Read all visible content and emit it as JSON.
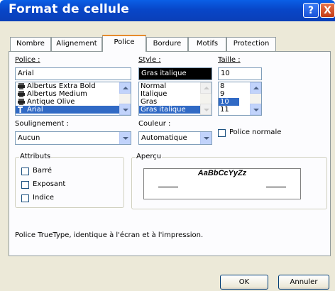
{
  "window": {
    "title": "Format de cellule",
    "help_glyph": "?",
    "close_glyph": "X"
  },
  "tabs": [
    {
      "label": "Nombre",
      "active": false
    },
    {
      "label": "Alignement",
      "active": false
    },
    {
      "label": "Police",
      "active": true
    },
    {
      "label": "Bordure",
      "active": false
    },
    {
      "label": "Motifs",
      "active": false
    },
    {
      "label": "Protection",
      "active": false
    }
  ],
  "police": {
    "label": "Police :",
    "value": "Arial",
    "items": [
      {
        "label": "Albertus Extra Bold",
        "icon": "printer-font-icon"
      },
      {
        "label": "Albertus Medium",
        "icon": "printer-font-icon"
      },
      {
        "label": "Antique Olive",
        "icon": "printer-font-icon"
      },
      {
        "label": "Arial",
        "icon": "truetype-icon",
        "selected": true
      }
    ]
  },
  "style": {
    "label": "Style :",
    "value": "Gras italique",
    "items": [
      {
        "label": "Normal"
      },
      {
        "label": "Italique"
      },
      {
        "label": "Gras"
      },
      {
        "label": "Gras italique",
        "selected": true
      }
    ]
  },
  "taille": {
    "label": "Taille :",
    "value": "10",
    "items": [
      {
        "label": "8"
      },
      {
        "label": "9"
      },
      {
        "label": "10",
        "selected": true
      },
      {
        "label": "11"
      }
    ]
  },
  "soulignement": {
    "label": "Soulignement :",
    "value": "Aucun"
  },
  "couleur": {
    "label": "Couleur :",
    "value": "Automatique"
  },
  "police_normale": {
    "label": "Police normale",
    "checked": false
  },
  "attributs": {
    "title": "Attributs",
    "items": [
      {
        "label": "Barré",
        "checked": false
      },
      {
        "label": "Exposant",
        "checked": false
      },
      {
        "label": "Indice",
        "checked": false
      }
    ]
  },
  "apercu": {
    "title": "Aperçu",
    "sample": "AaBbCcYyZz"
  },
  "info": "Police TrueType, identique à l'écran et à l'impression.",
  "buttons": {
    "ok": "OK",
    "cancel": "Annuler"
  },
  "colors": {
    "title_bar": "#0846c8",
    "dialog_bg": "#ece9d8",
    "selection": "#316ac5",
    "tab_highlight": "#e68b2c"
  }
}
